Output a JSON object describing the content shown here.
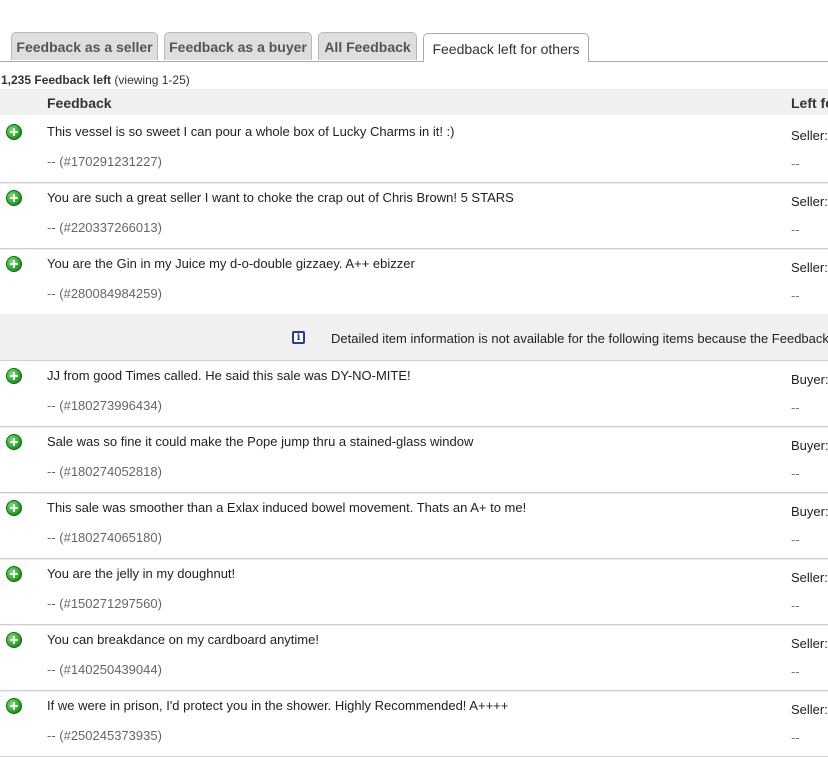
{
  "tabs": [
    {
      "label": "Feedback as a seller",
      "active": false
    },
    {
      "label": "Feedback as a buyer",
      "active": false
    },
    {
      "label": "All Feedback",
      "active": false
    },
    {
      "label": "Feedback left for others",
      "active": true
    }
  ],
  "summary": {
    "count": "1,235 Feedback left",
    "viewing": "(viewing 1-25)"
  },
  "table": {
    "columns": [
      "Feedback",
      "Left for"
    ]
  },
  "rows_top": [
    {
      "comment": "This vessel is so sweet I can pour a whole box of Lucky Charms in it! :)",
      "item": "-- (#170291231227)",
      "role": "Seller:",
      "role_detail": "--"
    },
    {
      "comment": "You are such a great seller I want to choke the crap out of Chris Brown! 5 STARS",
      "item": "-- (#220337266013)",
      "role": "Seller:",
      "role_detail": "--"
    },
    {
      "comment": "You are the Gin in my Juice my d-o-double gizzaey. A++ ebizzer",
      "item": "-- (#280084984259)",
      "role": "Seller:",
      "role_detail": "--"
    }
  ],
  "notice": {
    "icon": "info-icon",
    "text": "Detailed item information is not available for the following items because the Feedback"
  },
  "rows_bottom": [
    {
      "comment": "JJ from good Times called. He said this sale was DY-NO-MITE!",
      "item": "-- (#180273996434)",
      "role": "Buyer:",
      "role_detail": "--"
    },
    {
      "comment": "Sale was so fine it could make the Pope jump thru a stained-glass window",
      "item": "-- (#180274052818)",
      "role": "Buyer:",
      "role_detail": "--"
    },
    {
      "comment": "This sale was smoother than a Exlax induced bowel movement. Thats an A+ to me!",
      "item": "-- (#180274065180)",
      "role": "Buyer:",
      "role_detail": "--"
    },
    {
      "comment": "You are the jelly in my doughnut!",
      "item": "-- (#150271297560)",
      "role": "Seller:",
      "role_detail": "--"
    },
    {
      "comment": "You can breakdance on my cardboard anytime!",
      "item": "-- (#140250439044)",
      "role": "Seller:",
      "role_detail": "--"
    },
    {
      "comment": "If we were in prison, I'd protect you in the shower. Highly Recommended! A++++",
      "item": "-- (#250245373935)",
      "role": "Seller:",
      "role_detail": "--"
    }
  ],
  "colors": {
    "positive": "#1b9a1b",
    "info": "#2a3a9a",
    "header_bg": "#f0f0f0"
  }
}
